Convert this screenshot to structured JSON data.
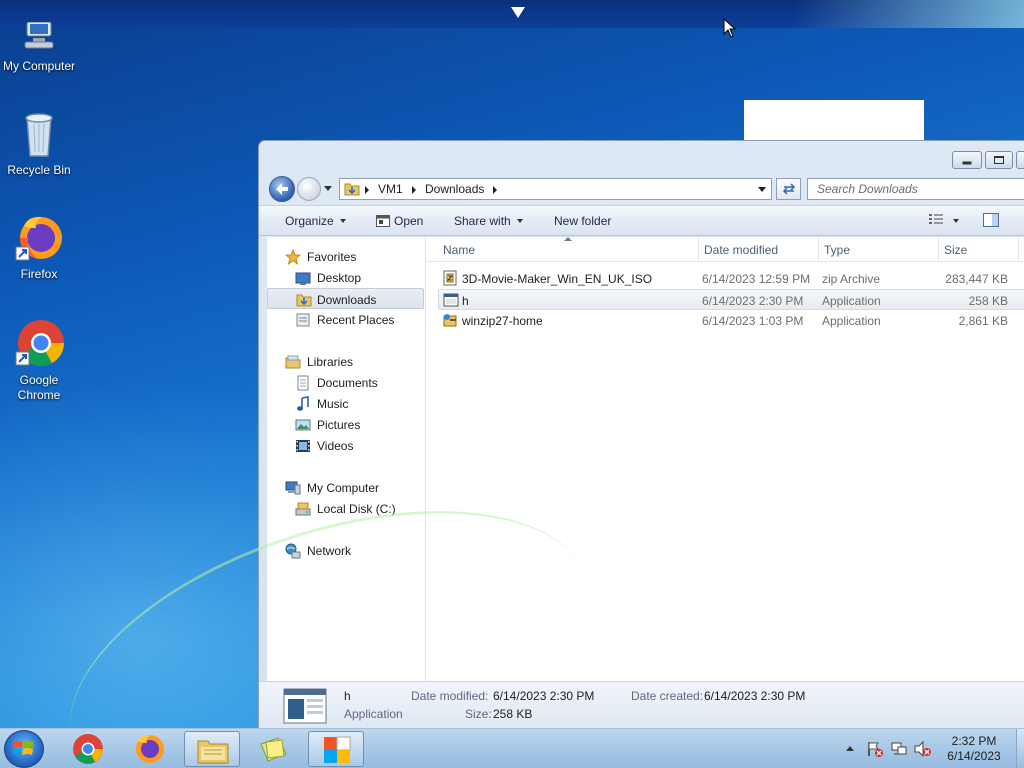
{
  "desktop": {
    "icons": [
      {
        "label": "My Computer",
        "icon": "my-computer-icon"
      },
      {
        "label": "Recycle Bin",
        "icon": "recycle-bin-icon"
      },
      {
        "label": "Firefox",
        "icon": "firefox-icon"
      },
      {
        "label": "Google Chrome",
        "icon": "chrome-icon"
      }
    ]
  },
  "explorer": {
    "address": {
      "crumbs": [
        "VM1",
        "Downloads"
      ]
    },
    "search": {
      "placeholder": "Search Downloads"
    },
    "toolbar": {
      "organize": "Organize",
      "open": "Open",
      "share_with": "Share with",
      "new_folder": "New folder"
    },
    "nav": {
      "favorites": "Favorites",
      "desktop": "Desktop",
      "downloads": "Downloads",
      "recent_places": "Recent Places",
      "libraries": "Libraries",
      "documents": "Documents",
      "music": "Music",
      "pictures": "Pictures",
      "videos": "Videos",
      "my_computer": "My Computer",
      "local_disk": "Local Disk (C:)",
      "network": "Network"
    },
    "columns": {
      "name": "Name",
      "date_modified": "Date modified",
      "type": "Type",
      "size": "Size"
    },
    "files": [
      {
        "name": "3D-Movie-Maker_Win_EN_UK_ISO",
        "date": "6/14/2023 12:59 PM",
        "type": "zip Archive",
        "size": "283,447 KB",
        "icon": "zip-archive-icon"
      },
      {
        "name": "h",
        "date": "6/14/2023 2:30 PM",
        "type": "Application",
        "size": "258 KB",
        "icon": "application-icon"
      },
      {
        "name": "winzip27-home",
        "date": "6/14/2023 1:03 PM",
        "type": "Application",
        "size": "2,861 KB",
        "icon": "installer-icon"
      }
    ],
    "selected_index": 1,
    "details": {
      "type": "Application",
      "date_modified_label": "Date modified:",
      "date_modified": "6/14/2023 2:30 PM",
      "date_created_label": "Date created:",
      "date_created": "6/14/2023 2:30 PM",
      "size_label": "Size:",
      "size": "258 KB"
    }
  },
  "taskbar": {
    "clock_time": "2:32 PM",
    "clock_date": "6/14/2023"
  }
}
